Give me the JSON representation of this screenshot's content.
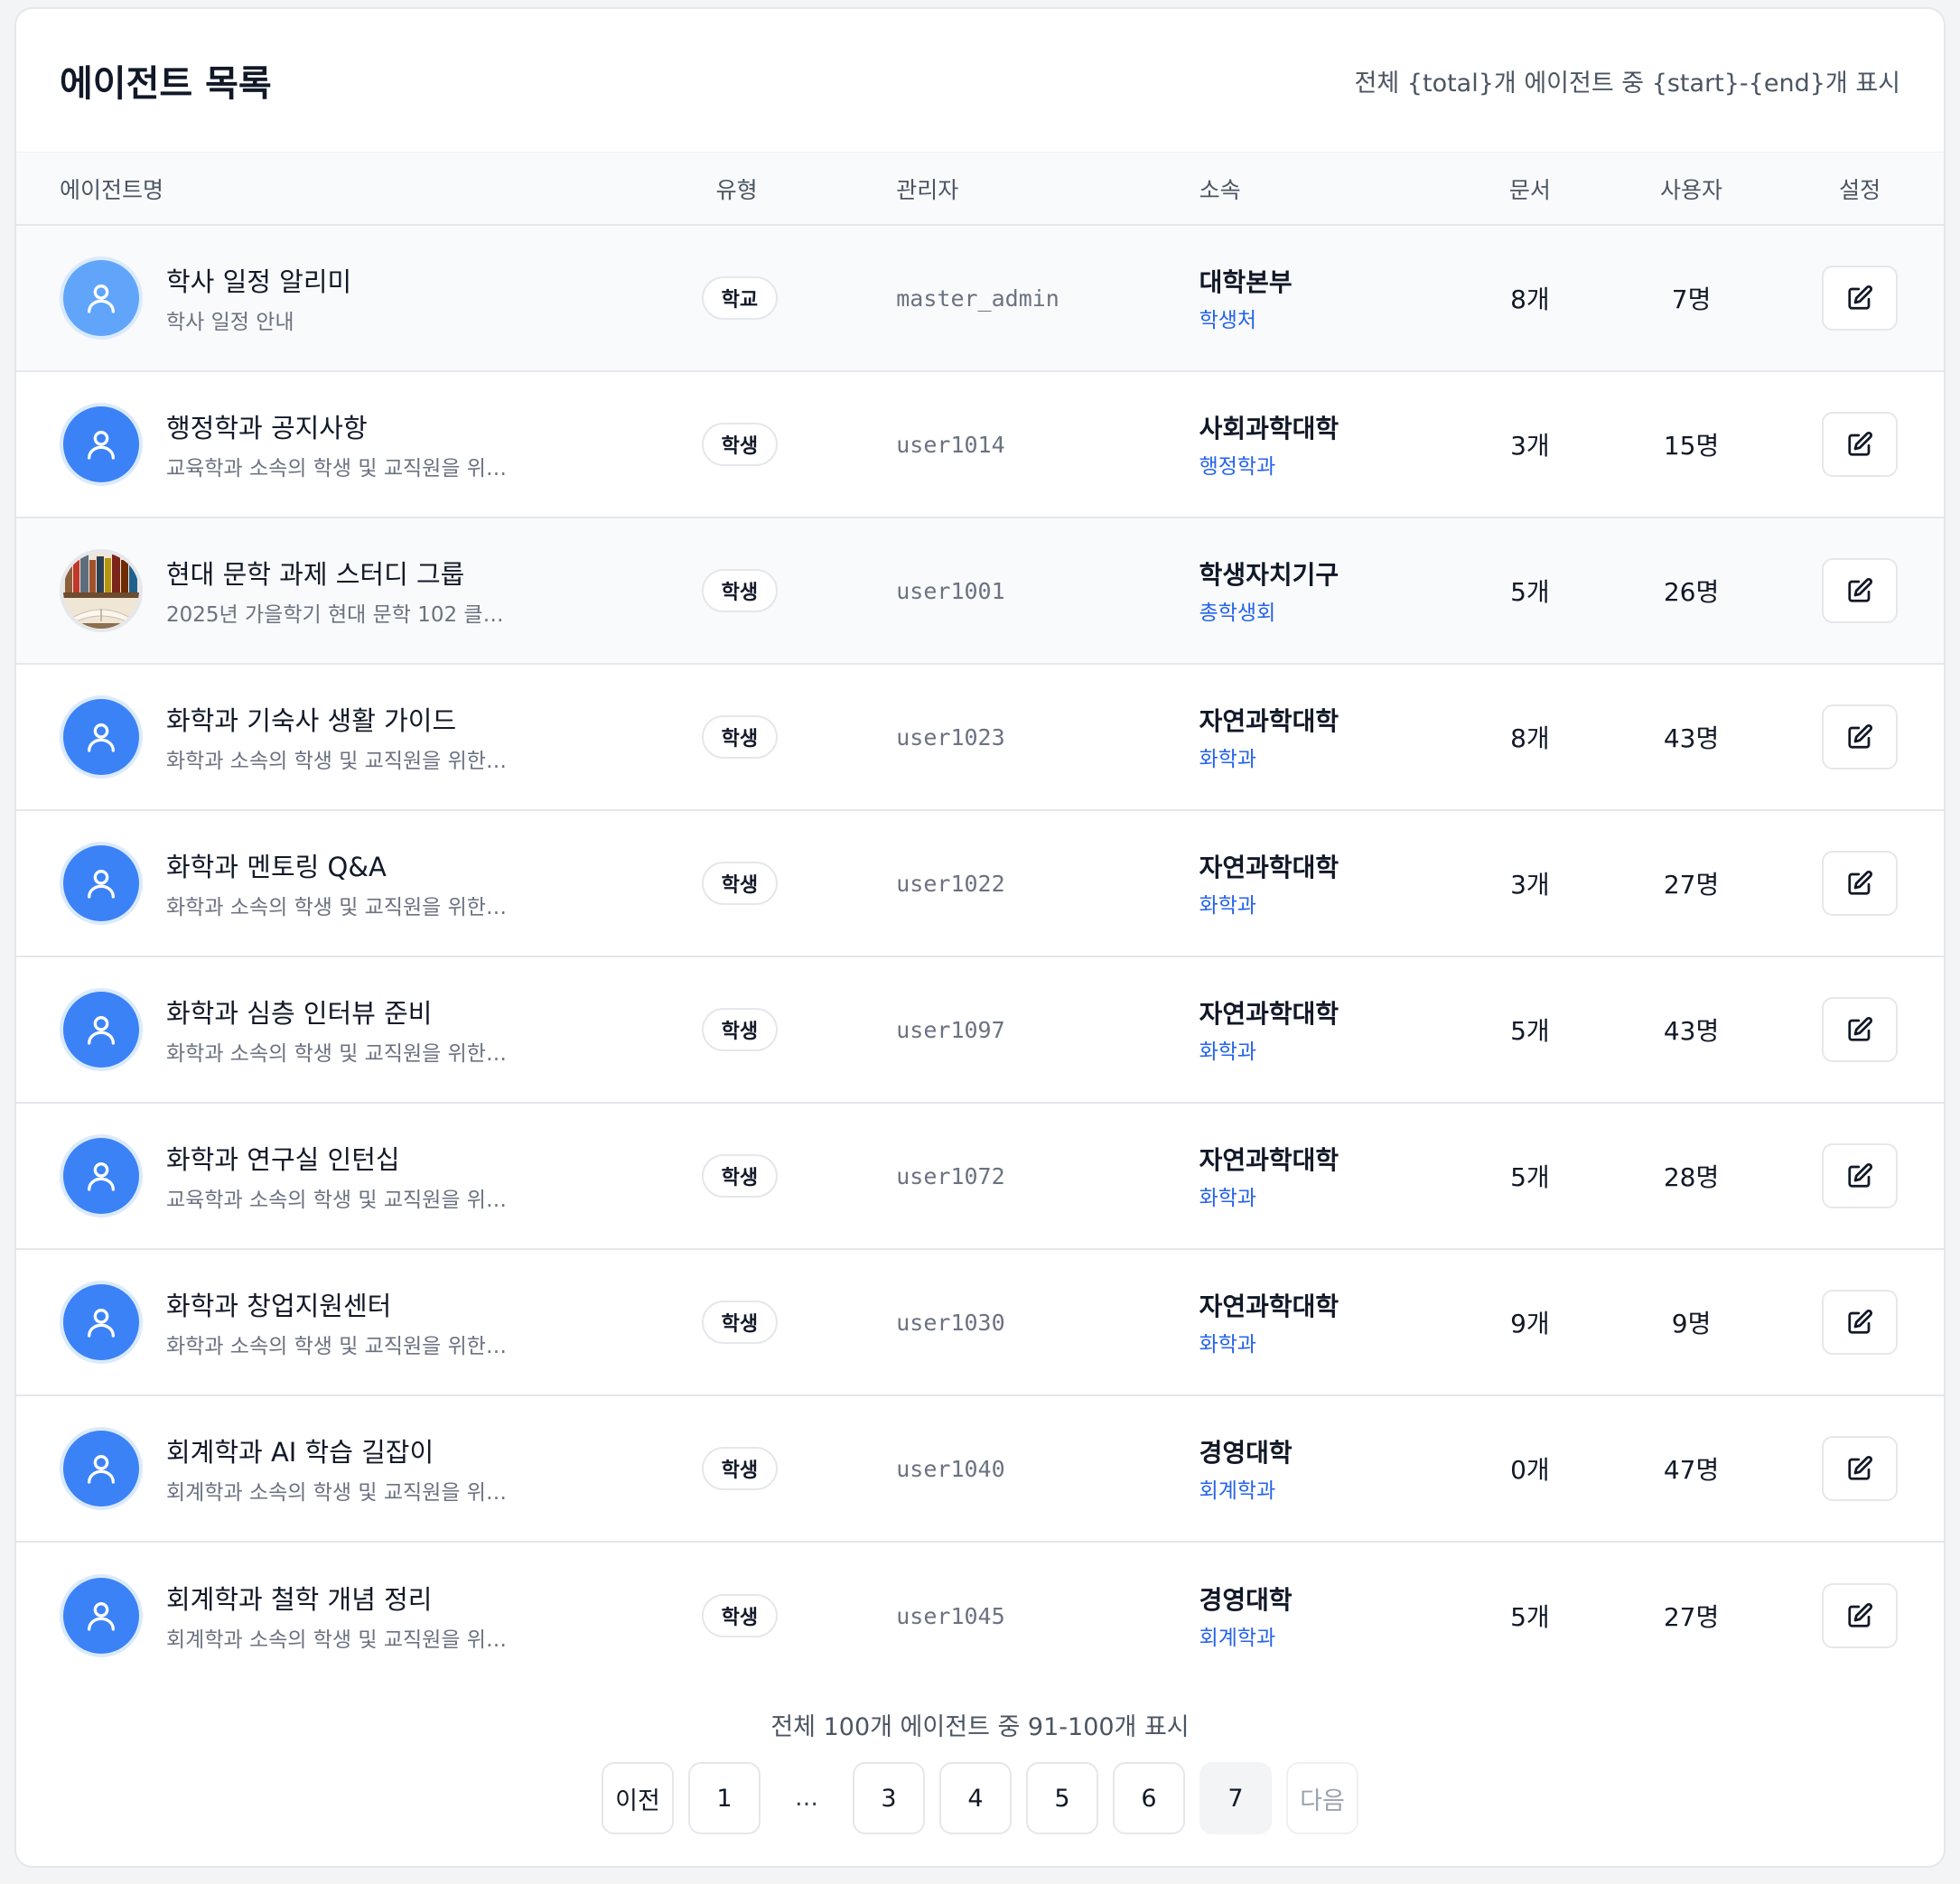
{
  "header": {
    "title": "에이전트 목록",
    "summary_template": "전체 {total}개 에이전트 중 {start}-{end}개 표시"
  },
  "columns": {
    "name": "에이전트명",
    "type": "유형",
    "manager": "관리자",
    "affiliation": "소속",
    "documents": "문서",
    "users": "사용자",
    "settings": "설정"
  },
  "rows": [
    {
      "title": "학사 일정 알리미",
      "desc": "학사 일정 안내",
      "type": "학교",
      "manager": "master_admin",
      "aff_main": "대학본부",
      "aff_sub": "학생처",
      "docs": "8개",
      "users": "7명",
      "avatar": "user-icon-light"
    },
    {
      "title": "행정학과 공지사항",
      "desc": "교육학과 소속의 학생 및 교직원을 위…",
      "type": "학생",
      "manager": "user1014",
      "aff_main": "사회과학대학",
      "aff_sub": "행정학과",
      "docs": "3개",
      "users": "15명",
      "avatar": "user-icon"
    },
    {
      "title": "현대 문학 과제 스터디 그룹",
      "desc": "2025년 가을학기 현대 문학 102 클…",
      "type": "학생",
      "manager": "user1001",
      "aff_main": "학생자치기구",
      "aff_sub": "총학생회",
      "docs": "5개",
      "users": "26명",
      "avatar": "books-photo"
    },
    {
      "title": "화학과 기숙사 생활 가이드",
      "desc": "화학과 소속의 학생 및 교직원을 위한…",
      "type": "학생",
      "manager": "user1023",
      "aff_main": "자연과학대학",
      "aff_sub": "화학과",
      "docs": "8개",
      "users": "43명",
      "avatar": "user-icon"
    },
    {
      "title": "화학과 멘토링 Q&A",
      "desc": "화학과 소속의 학생 및 교직원을 위한…",
      "type": "학생",
      "manager": "user1022",
      "aff_main": "자연과학대학",
      "aff_sub": "화학과",
      "docs": "3개",
      "users": "27명",
      "avatar": "user-icon"
    },
    {
      "title": "화학과 심층 인터뷰 준비",
      "desc": "화학과 소속의 학생 및 교직원을 위한…",
      "type": "학생",
      "manager": "user1097",
      "aff_main": "자연과학대학",
      "aff_sub": "화학과",
      "docs": "5개",
      "users": "43명",
      "avatar": "user-icon"
    },
    {
      "title": "화학과 연구실 인턴십",
      "desc": "교육학과 소속의 학생 및 교직원을 위…",
      "type": "학생",
      "manager": "user1072",
      "aff_main": "자연과학대학",
      "aff_sub": "화학과",
      "docs": "5개",
      "users": "28명",
      "avatar": "user-icon"
    },
    {
      "title": "화학과 창업지원센터",
      "desc": "화학과 소속의 학생 및 교직원을 위한…",
      "type": "학생",
      "manager": "user1030",
      "aff_main": "자연과학대학",
      "aff_sub": "화학과",
      "docs": "9개",
      "users": "9명",
      "avatar": "user-icon"
    },
    {
      "title": "회계학과 AI 학습 길잡이",
      "desc": "회계학과 소속의 학생 및 교직원을 위…",
      "type": "학생",
      "manager": "user1040",
      "aff_main": "경영대학",
      "aff_sub": "회계학과",
      "docs": "0개",
      "users": "47명",
      "avatar": "user-icon"
    },
    {
      "title": "회계학과 철학 개념 정리",
      "desc": "회계학과 소속의 학생 및 교직원을 위…",
      "type": "학생",
      "manager": "user1045",
      "aff_main": "경영대학",
      "aff_sub": "회계학과",
      "docs": "5개",
      "users": "27명",
      "avatar": "user-icon"
    }
  ],
  "footer": {
    "summary": "전체 100개 에이전트 중 91-100개 표시",
    "prev_label": "이전",
    "next_label": "다음",
    "pages": [
      "1",
      "…",
      "3",
      "4",
      "5",
      "6",
      "7"
    ],
    "current_page": "7"
  },
  "icons": {
    "avatar": "user-icon",
    "edit": "edit-icon"
  },
  "colors": {
    "accent": "#3b82f6",
    "link": "#2563eb"
  }
}
